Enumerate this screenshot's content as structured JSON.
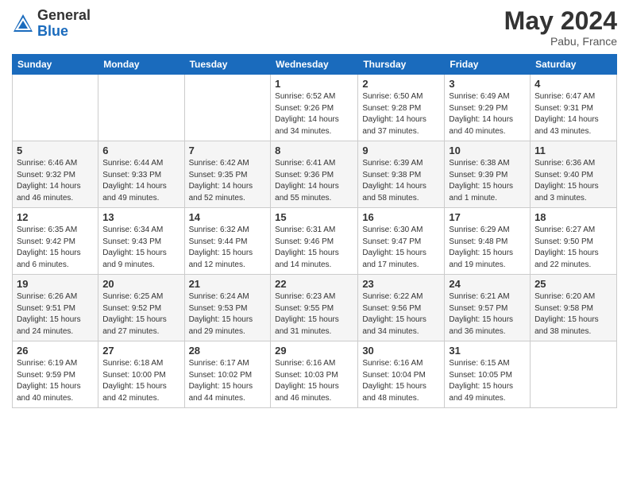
{
  "header": {
    "logo_general": "General",
    "logo_blue": "Blue",
    "month_year": "May 2024",
    "location": "Pabu, France"
  },
  "weekdays": [
    "Sunday",
    "Monday",
    "Tuesday",
    "Wednesday",
    "Thursday",
    "Friday",
    "Saturday"
  ],
  "weeks": [
    [
      {
        "day": "",
        "info": ""
      },
      {
        "day": "",
        "info": ""
      },
      {
        "day": "",
        "info": ""
      },
      {
        "day": "1",
        "info": "Sunrise: 6:52 AM\nSunset: 9:26 PM\nDaylight: 14 hours\nand 34 minutes."
      },
      {
        "day": "2",
        "info": "Sunrise: 6:50 AM\nSunset: 9:28 PM\nDaylight: 14 hours\nand 37 minutes."
      },
      {
        "day": "3",
        "info": "Sunrise: 6:49 AM\nSunset: 9:29 PM\nDaylight: 14 hours\nand 40 minutes."
      },
      {
        "day": "4",
        "info": "Sunrise: 6:47 AM\nSunset: 9:31 PM\nDaylight: 14 hours\nand 43 minutes."
      }
    ],
    [
      {
        "day": "5",
        "info": "Sunrise: 6:46 AM\nSunset: 9:32 PM\nDaylight: 14 hours\nand 46 minutes."
      },
      {
        "day": "6",
        "info": "Sunrise: 6:44 AM\nSunset: 9:33 PM\nDaylight: 14 hours\nand 49 minutes."
      },
      {
        "day": "7",
        "info": "Sunrise: 6:42 AM\nSunset: 9:35 PM\nDaylight: 14 hours\nand 52 minutes."
      },
      {
        "day": "8",
        "info": "Sunrise: 6:41 AM\nSunset: 9:36 PM\nDaylight: 14 hours\nand 55 minutes."
      },
      {
        "day": "9",
        "info": "Sunrise: 6:39 AM\nSunset: 9:38 PM\nDaylight: 14 hours\nand 58 minutes."
      },
      {
        "day": "10",
        "info": "Sunrise: 6:38 AM\nSunset: 9:39 PM\nDaylight: 15 hours\nand 1 minute."
      },
      {
        "day": "11",
        "info": "Sunrise: 6:36 AM\nSunset: 9:40 PM\nDaylight: 15 hours\nand 3 minutes."
      }
    ],
    [
      {
        "day": "12",
        "info": "Sunrise: 6:35 AM\nSunset: 9:42 PM\nDaylight: 15 hours\nand 6 minutes."
      },
      {
        "day": "13",
        "info": "Sunrise: 6:34 AM\nSunset: 9:43 PM\nDaylight: 15 hours\nand 9 minutes."
      },
      {
        "day": "14",
        "info": "Sunrise: 6:32 AM\nSunset: 9:44 PM\nDaylight: 15 hours\nand 12 minutes."
      },
      {
        "day": "15",
        "info": "Sunrise: 6:31 AM\nSunset: 9:46 PM\nDaylight: 15 hours\nand 14 minutes."
      },
      {
        "day": "16",
        "info": "Sunrise: 6:30 AM\nSunset: 9:47 PM\nDaylight: 15 hours\nand 17 minutes."
      },
      {
        "day": "17",
        "info": "Sunrise: 6:29 AM\nSunset: 9:48 PM\nDaylight: 15 hours\nand 19 minutes."
      },
      {
        "day": "18",
        "info": "Sunrise: 6:27 AM\nSunset: 9:50 PM\nDaylight: 15 hours\nand 22 minutes."
      }
    ],
    [
      {
        "day": "19",
        "info": "Sunrise: 6:26 AM\nSunset: 9:51 PM\nDaylight: 15 hours\nand 24 minutes."
      },
      {
        "day": "20",
        "info": "Sunrise: 6:25 AM\nSunset: 9:52 PM\nDaylight: 15 hours\nand 27 minutes."
      },
      {
        "day": "21",
        "info": "Sunrise: 6:24 AM\nSunset: 9:53 PM\nDaylight: 15 hours\nand 29 minutes."
      },
      {
        "day": "22",
        "info": "Sunrise: 6:23 AM\nSunset: 9:55 PM\nDaylight: 15 hours\nand 31 minutes."
      },
      {
        "day": "23",
        "info": "Sunrise: 6:22 AM\nSunset: 9:56 PM\nDaylight: 15 hours\nand 34 minutes."
      },
      {
        "day": "24",
        "info": "Sunrise: 6:21 AM\nSunset: 9:57 PM\nDaylight: 15 hours\nand 36 minutes."
      },
      {
        "day": "25",
        "info": "Sunrise: 6:20 AM\nSunset: 9:58 PM\nDaylight: 15 hours\nand 38 minutes."
      }
    ],
    [
      {
        "day": "26",
        "info": "Sunrise: 6:19 AM\nSunset: 9:59 PM\nDaylight: 15 hours\nand 40 minutes."
      },
      {
        "day": "27",
        "info": "Sunrise: 6:18 AM\nSunset: 10:00 PM\nDaylight: 15 hours\nand 42 minutes."
      },
      {
        "day": "28",
        "info": "Sunrise: 6:17 AM\nSunset: 10:02 PM\nDaylight: 15 hours\nand 44 minutes."
      },
      {
        "day": "29",
        "info": "Sunrise: 6:16 AM\nSunset: 10:03 PM\nDaylight: 15 hours\nand 46 minutes."
      },
      {
        "day": "30",
        "info": "Sunrise: 6:16 AM\nSunset: 10:04 PM\nDaylight: 15 hours\nand 48 minutes."
      },
      {
        "day": "31",
        "info": "Sunrise: 6:15 AM\nSunset: 10:05 PM\nDaylight: 15 hours\nand 49 minutes."
      },
      {
        "day": "",
        "info": ""
      }
    ]
  ]
}
